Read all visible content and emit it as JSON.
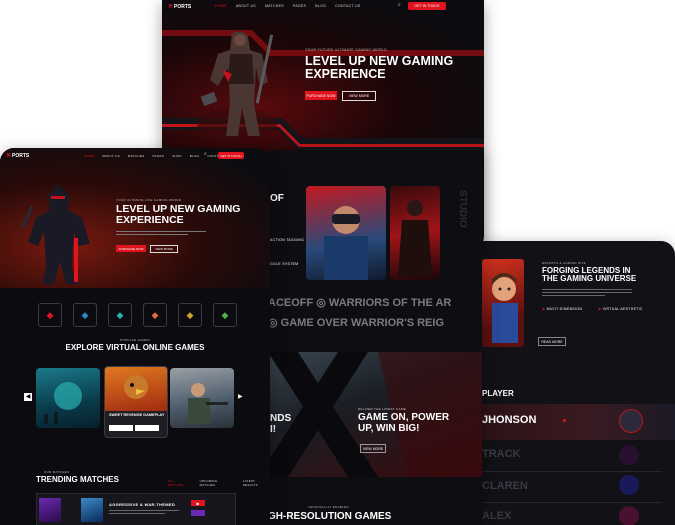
{
  "brand": {
    "logo_text": "PORTS",
    "accent": "#e0141e"
  },
  "back_site": {
    "nav": [
      "HOME",
      "ABOUT US",
      "MATCHES",
      "PAGES",
      "BLOG",
      "CONTACT US"
    ],
    "cta": "GET IN TOUCH",
    "hero_kicker": "YOUR FUTURE ULTIMATE GAMING WORLD",
    "hero_title_1": "LEVEL UP NEW GAMING",
    "hero_title_2": "EXPERIENCE",
    "btn_primary": "PURCHASE NOW",
    "btn_secondary": "VIEW MORE"
  },
  "front_site": {
    "nav": [
      "HOME",
      "ABOUT US",
      "MATCHES",
      "PAGES",
      "SHOP",
      "BLOG",
      "CONTACT US"
    ],
    "cta": "GET IN TOUCH",
    "hero_kicker": "YOUR ULTIMATE LIVE GAMING WORLD",
    "hero_title_1": "LEVEL UP NEW GAMING",
    "hero_title_2": "EXPERIENCE",
    "btn_primary": "PURCHASE NOW",
    "btn_secondary": "VIEW MORE",
    "explore_kicker": "POPULAR GAMES",
    "explore_title": "EXPLORE VIRTUAL ONLINE GAMES",
    "game_card_title": "SWEET REVENGE GAMEPLAY",
    "trending_kicker": "OUR MATCHES",
    "trending_title": "TRENDING MATCHES",
    "trending_tabs": [
      "ALL MATCHES",
      "UPCOMING MATCHES",
      "LATEST RESULTS"
    ],
    "match_title": "AGGRESSIVE & WAR-THEMED"
  },
  "middle_site": {
    "top_heading": "OF",
    "features": [
      "ACTION TAGGING",
      "GGLE SYSTEM"
    ],
    "marquee_1": "ACEOFF ◎ WARRIORS OF THE AR",
    "marquee_2": "◎ GAME OVER WARRIOR'S REIG",
    "banner_left": "NDS",
    "banner_left_2": "I!",
    "banner_kicker": "DELIVER THE LATEST GAME",
    "banner_title_1": "GAME ON, POWER",
    "banner_title_2": "UP, WIN BIG!",
    "banner_btn": "VIEW MORE",
    "bottom_kicker": "TECHNICALLY ENABLED",
    "bottom_title": "GH-RESOLUTION GAMES"
  },
  "right_site": {
    "kicker": "ESPORTS & GAMING SITE",
    "title_1": "FORGING LEGENDS IN",
    "title_2": "THE GAMING UNIVERSE",
    "feature_1": "MULTI DIMENSION",
    "feature_2": "VIRTUAL AESTHETIC",
    "btn": "READ MORE",
    "player_heading": "PLAYER",
    "players": [
      "JHONSON",
      "TRACK",
      "CLAREN",
      "ALEX"
    ]
  }
}
